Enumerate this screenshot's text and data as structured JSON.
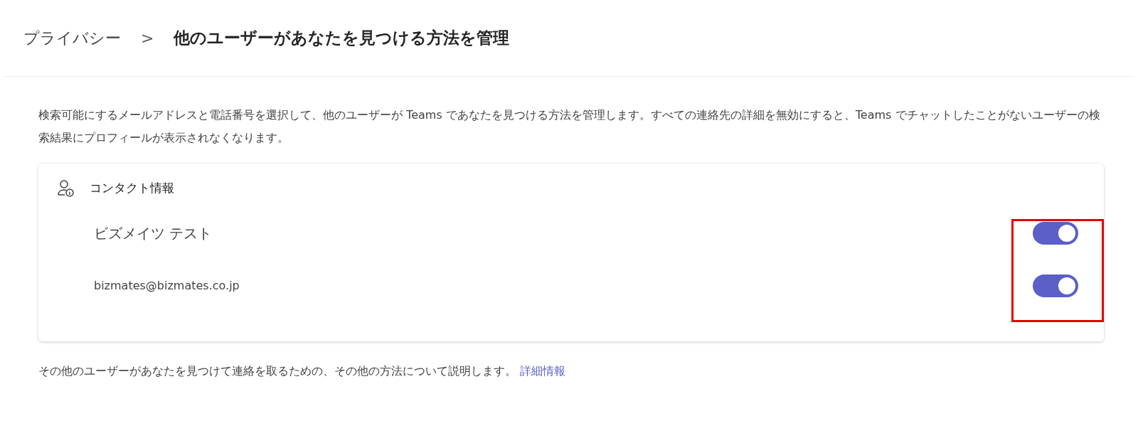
{
  "breadcrumb": {
    "parent": "プライバシー",
    "separator": ">",
    "current": "他のユーザーがあなたを見つける方法を管理"
  },
  "description": "検索可能にするメールアドレスと電話番号を選択して、他のユーザーが Teams であなたを見つける方法を管理します。すべての連絡先の詳細を無効にすると、Teams でチャットしたことがないユーザーの検索結果にプロフィールが表示されなくなります。",
  "card": {
    "title": "コンタクト情報",
    "toggles_highlighted": true,
    "items": [
      {
        "label": "ビズメイツ テスト",
        "kind": "name",
        "on": true
      },
      {
        "label": "bizmates@bizmates.co.jp",
        "kind": "email",
        "on": true
      }
    ]
  },
  "footer": {
    "text": "その他のユーザーがあなたを見つけて連絡を取るための、その他の方法について説明します。",
    "link": "詳細情報"
  }
}
